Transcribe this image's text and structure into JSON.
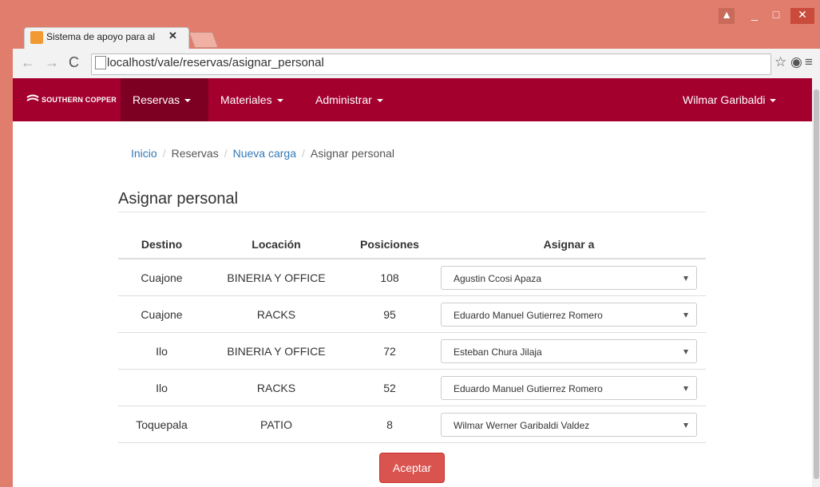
{
  "browser": {
    "tab_title": "Sistema de apoyo para al",
    "url": "localhost/vale/reservas/asignar_personal"
  },
  "navbar": {
    "brand": "SOUTHERN COPPER",
    "items": [
      {
        "label": "Reservas"
      },
      {
        "label": "Materiales"
      },
      {
        "label": "Administrar"
      }
    ],
    "user": "Wilmar Garibaldi"
  },
  "breadcrumb": {
    "items": [
      "Inicio",
      "Reservas",
      "Nueva carga",
      "Asignar personal"
    ]
  },
  "page_title": "Asignar personal",
  "table": {
    "headers": [
      "Destino",
      "Locación",
      "Posiciones",
      "Asignar a"
    ],
    "rows": [
      {
        "destino": "Cuajone",
        "locacion": "BINERIA Y OFFICE",
        "posiciones": "108",
        "asignado": "Agustin Ccosi Apaza"
      },
      {
        "destino": "Cuajone",
        "locacion": "RACKS",
        "posiciones": "95",
        "asignado": "Eduardo Manuel Gutierrez Romero"
      },
      {
        "destino": "Ilo",
        "locacion": "BINERIA Y OFFICE",
        "posiciones": "72",
        "asignado": "Esteban Chura Jilaja"
      },
      {
        "destino": "Ilo",
        "locacion": "RACKS",
        "posiciones": "52",
        "asignado": "Eduardo Manuel Gutierrez Romero"
      },
      {
        "destino": "Toquepala",
        "locacion": "PATIO",
        "posiciones": "8",
        "asignado": "Wilmar Werner Garibaldi Valdez"
      }
    ]
  },
  "submit_label": "Aceptar",
  "colors": {
    "navbar": "#a3002e",
    "chrome": "#e07d6c",
    "button": "#d9534f"
  }
}
